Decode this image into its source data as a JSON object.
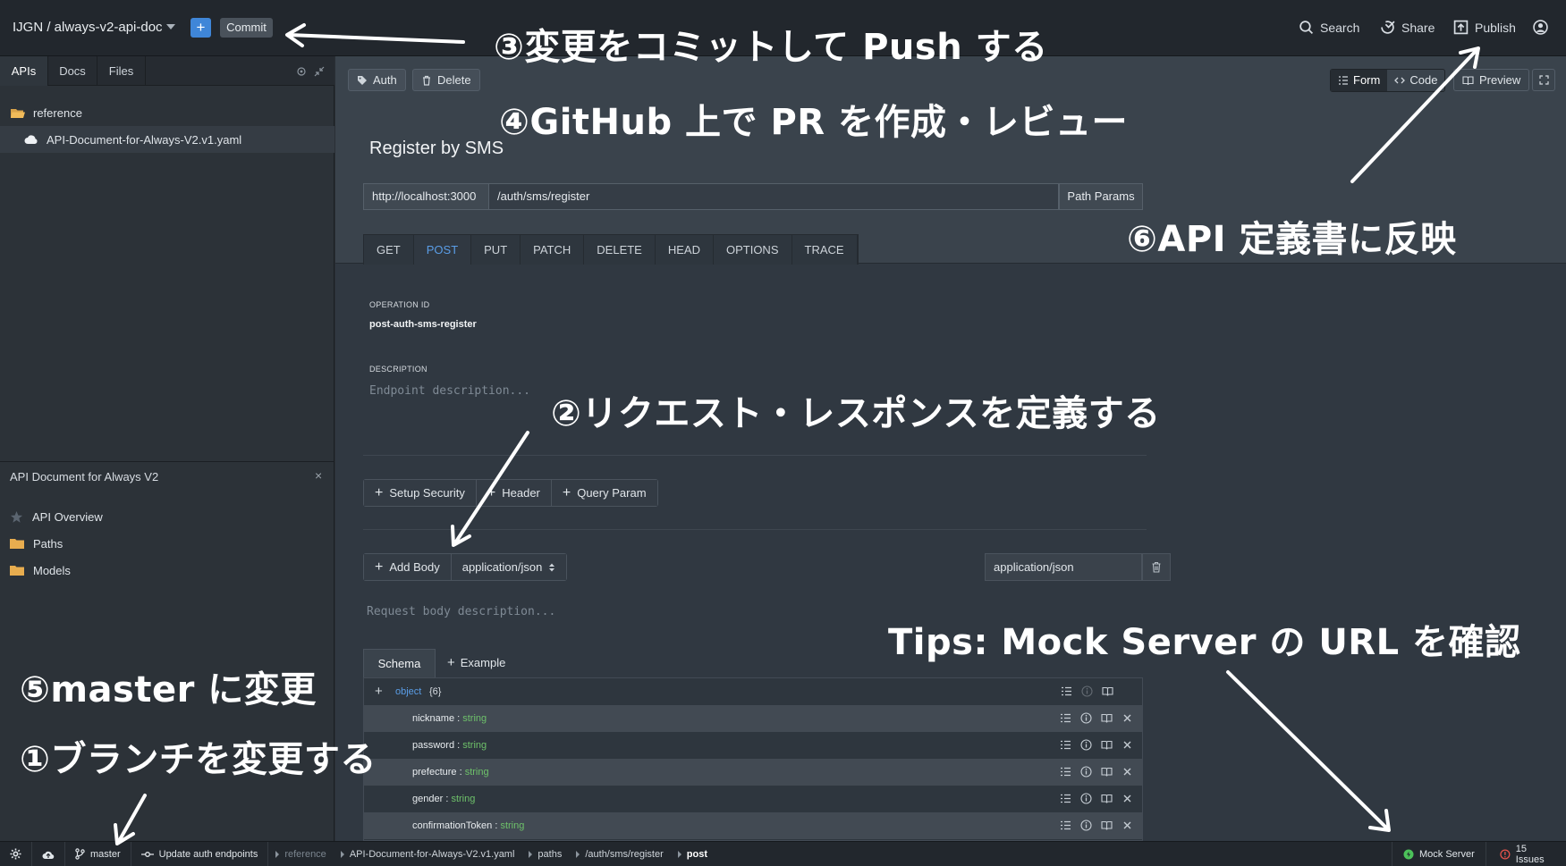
{
  "app": {
    "project_name": "IJGN / always-v2-api-doc",
    "plus_label": "+",
    "commit_label": "Commit",
    "nav": {
      "search": "Search",
      "share": "Share",
      "publish": "Publish"
    }
  },
  "left_panel": {
    "tabs": [
      "APIs",
      "Docs",
      "Files"
    ],
    "tree": {
      "folder": "reference",
      "file": "API-Document-for-Always-V2.v1.yaml"
    },
    "lower_title": "API Document for Always V2",
    "lower_close": "×",
    "nav_items": [
      "API Overview",
      "Paths",
      "Models"
    ]
  },
  "toolbar": {
    "auth": "Auth",
    "delete": "Delete",
    "form": "Form",
    "code": "Code",
    "preview": "Preview"
  },
  "endpoint": {
    "title": "Register by SMS",
    "server": "http://localhost:3000",
    "path": "/auth/sms/register",
    "path_params": "Path Params",
    "methods": [
      "GET",
      "POST",
      "PUT",
      "PATCH",
      "DELETE",
      "HEAD",
      "OPTIONS",
      "TRACE"
    ],
    "active_method": "POST",
    "operation_id_label": "OPERATION ID",
    "operation_id": "post-auth-sms-register",
    "description_label": "DESCRIPTION",
    "description_placeholder": "Endpoint description...",
    "buttons": [
      "Setup Security",
      "Header",
      "Query Param"
    ],
    "add_body": "Add Body",
    "content_type": "application/json",
    "content_type_right": "application/json",
    "body_placeholder": "Request body description...",
    "schema_tab": "Schema",
    "example_tab": "Example",
    "schema_root": {
      "type": "object",
      "count": "{6}"
    },
    "fields": [
      {
        "name": "nickname",
        "type": "string"
      },
      {
        "name": "password",
        "type": "string"
      },
      {
        "name": "prefecture",
        "type": "string"
      },
      {
        "name": "gender",
        "type": "string"
      },
      {
        "name": "confirmationToken",
        "type": "string"
      }
    ]
  },
  "statusbar": {
    "branch": "master",
    "commit_message": "Update auth endpoints",
    "breadcrumbs": [
      "reference",
      "API-Document-for-Always-V2.v1.yaml",
      "paths",
      "/auth/sms/register",
      "post"
    ],
    "mock_server": "Mock Server",
    "issues": "15 Issues"
  },
  "annotations": {
    "a3": "③変更をコミットして Push する",
    "a4": "④GitHub 上で PR を作成・レビュー",
    "a6": "⑥API 定義書に反映",
    "a2": "②リクエスト・レスポンスを定義する",
    "tips": "Tips: Mock Server の URL を確認",
    "a5": "⑤master に変更",
    "a1": "①ブランチを変更する"
  },
  "colors": {
    "accent": "#3f86d8",
    "active_tab": "#5a9de6",
    "type_string": "#6ec16a",
    "mock_green": "#4cc25a",
    "issues_red": "#e5534b"
  }
}
